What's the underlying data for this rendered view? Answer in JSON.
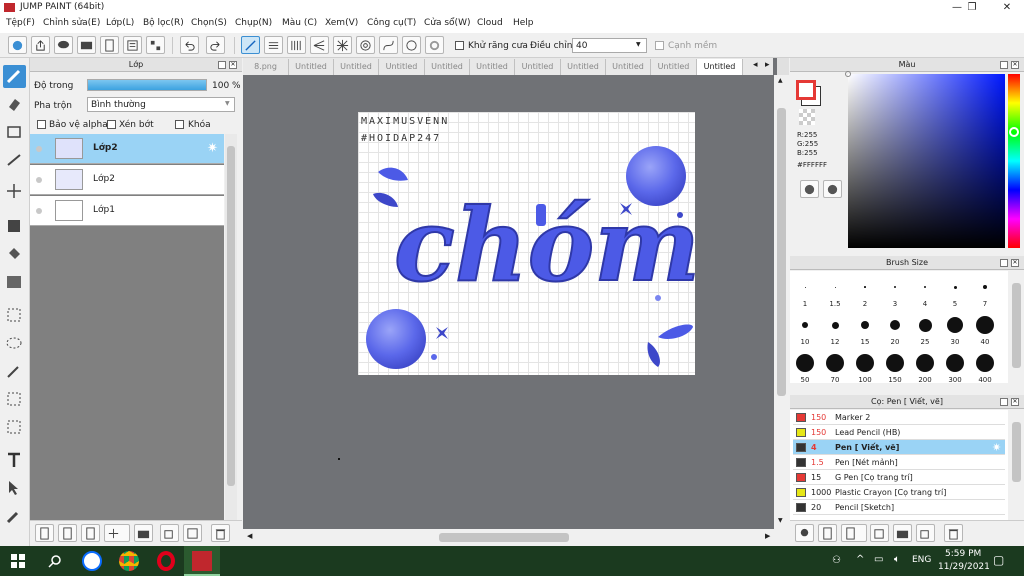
{
  "window": {
    "title": "JUMP PAINT (64bit)",
    "min": "—",
    "max": "❐",
    "close": "✕"
  },
  "menu": [
    "Tệp(F)",
    "Chỉnh sửa(E)",
    "Lớp(L)",
    "Bộ lọc(R)",
    "Chọn(S)",
    "Chụp(N)",
    "Màu (C)",
    "Xem(V)",
    "Công cụ(T)",
    "Cửa sổ(W)",
    "Cloud",
    "Help"
  ],
  "toolbar": {
    "antialias_label": "Khử răng cưa",
    "adjust_label": "Điều chỉnh",
    "adjust_value": "40",
    "sharp_label": "Cạnh mềm"
  },
  "layer_panel": {
    "title": "Lớp",
    "opacity_label": "Độ trong",
    "opacity_value": "100 %",
    "opacity_fraction": 1.0,
    "blend_label": "Pha trộn",
    "blend_value": "Bình thường",
    "protect_alpha": "Bảo vệ alpha",
    "clip": "Xén bớt",
    "lock": "Khóa",
    "layers": [
      {
        "name": "Lớp2",
        "selected": true
      },
      {
        "name": "Lớp2",
        "selected": false
      },
      {
        "name": "Lớp1",
        "selected": false
      }
    ]
  },
  "tabs": [
    {
      "label": "8.png"
    },
    {
      "label": "Untitled"
    },
    {
      "label": "Untitled"
    },
    {
      "label": "Untitled"
    },
    {
      "label": "Untitled"
    },
    {
      "label": "Untitled"
    },
    {
      "label": "Untitled"
    },
    {
      "label": "Untitled"
    },
    {
      "label": "Untitled"
    },
    {
      "label": "Untitled"
    },
    {
      "label": "Untitled"
    }
  ],
  "canvas": {
    "line1": "MAXIMUSVENN",
    "line2": "#HOIDAP247",
    "art_text": "chóm"
  },
  "color_panel": {
    "title": "Màu",
    "r": "R:255",
    "g": "G:255",
    "b": "B:255",
    "hex": "#FFFFFF"
  },
  "brush_size_panel": {
    "title": "Brush Size",
    "sizes": [
      "1",
      "1.5",
      "2",
      "3",
      "4",
      "5",
      "7",
      "10",
      "12",
      "15",
      "20",
      "25",
      "30",
      "40",
      "50",
      "70",
      "100",
      "150",
      "200",
      "300",
      "400"
    ]
  },
  "brush_panel": {
    "title": "Cọ: Pen [ Viết, vẽ]",
    "items": [
      {
        "color": "#e53935",
        "size": "150",
        "name": "Marker 2"
      },
      {
        "color": "#e6e616",
        "size": "150",
        "name": "Lead Pencil (HB)"
      },
      {
        "color": "#333333",
        "size": "4",
        "name": "Pen [ Viết, vẽ]",
        "selected": true
      },
      {
        "color": "#333333",
        "size": "1.5",
        "name": "Pen [Nét mảnh]"
      },
      {
        "color": "#e53935",
        "size": "15",
        "name": "G Pen [Cọ trang trí]"
      },
      {
        "color": "#e6e616",
        "size": "1000",
        "name": "Plastic Crayon [Cọ trang trí]"
      },
      {
        "color": "#333333",
        "size": "20",
        "name": "Pencil [Sketch]"
      }
    ]
  },
  "taskbar": {
    "lang": "ENG",
    "time": "5:59 PM",
    "date": "11/29/2021"
  },
  "colors": {
    "accent": "#3b8fd4",
    "selection": "#9ad3f5",
    "art_blue": "#4c5ae6"
  }
}
